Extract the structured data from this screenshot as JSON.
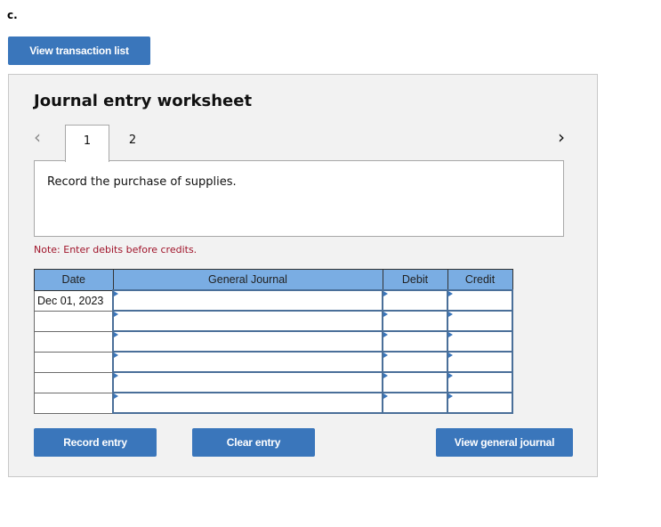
{
  "part_label": "c.",
  "view_transaction_list": "View transaction list",
  "worksheet": {
    "title": "Journal entry worksheet",
    "nav_prev_icon": "‹",
    "nav_next_icon": "›",
    "tabs": [
      {
        "label": "1",
        "active": true
      },
      {
        "label": "2",
        "active": false
      }
    ],
    "description": "Record the purchase of supplies.",
    "note": "Note: Enter debits before credits.",
    "table": {
      "headers": [
        "Date",
        "General Journal",
        "Debit",
        "Credit"
      ],
      "rows": [
        {
          "date": "Dec 01, 2023",
          "account": "",
          "debit": "",
          "credit": ""
        },
        {
          "date": "",
          "account": "",
          "debit": "",
          "credit": ""
        },
        {
          "date": "",
          "account": "",
          "debit": "",
          "credit": ""
        },
        {
          "date": "",
          "account": "",
          "debit": "",
          "credit": ""
        },
        {
          "date": "",
          "account": "",
          "debit": "",
          "credit": ""
        },
        {
          "date": "",
          "account": "",
          "debit": "",
          "credit": ""
        }
      ]
    },
    "buttons": {
      "record": "Record entry",
      "clear": "Clear entry",
      "view_general_journal": "View general journal"
    }
  },
  "colors": {
    "button_blue": "#3a76bb",
    "header_blue": "#7aade3",
    "note_red": "#a0142a"
  }
}
